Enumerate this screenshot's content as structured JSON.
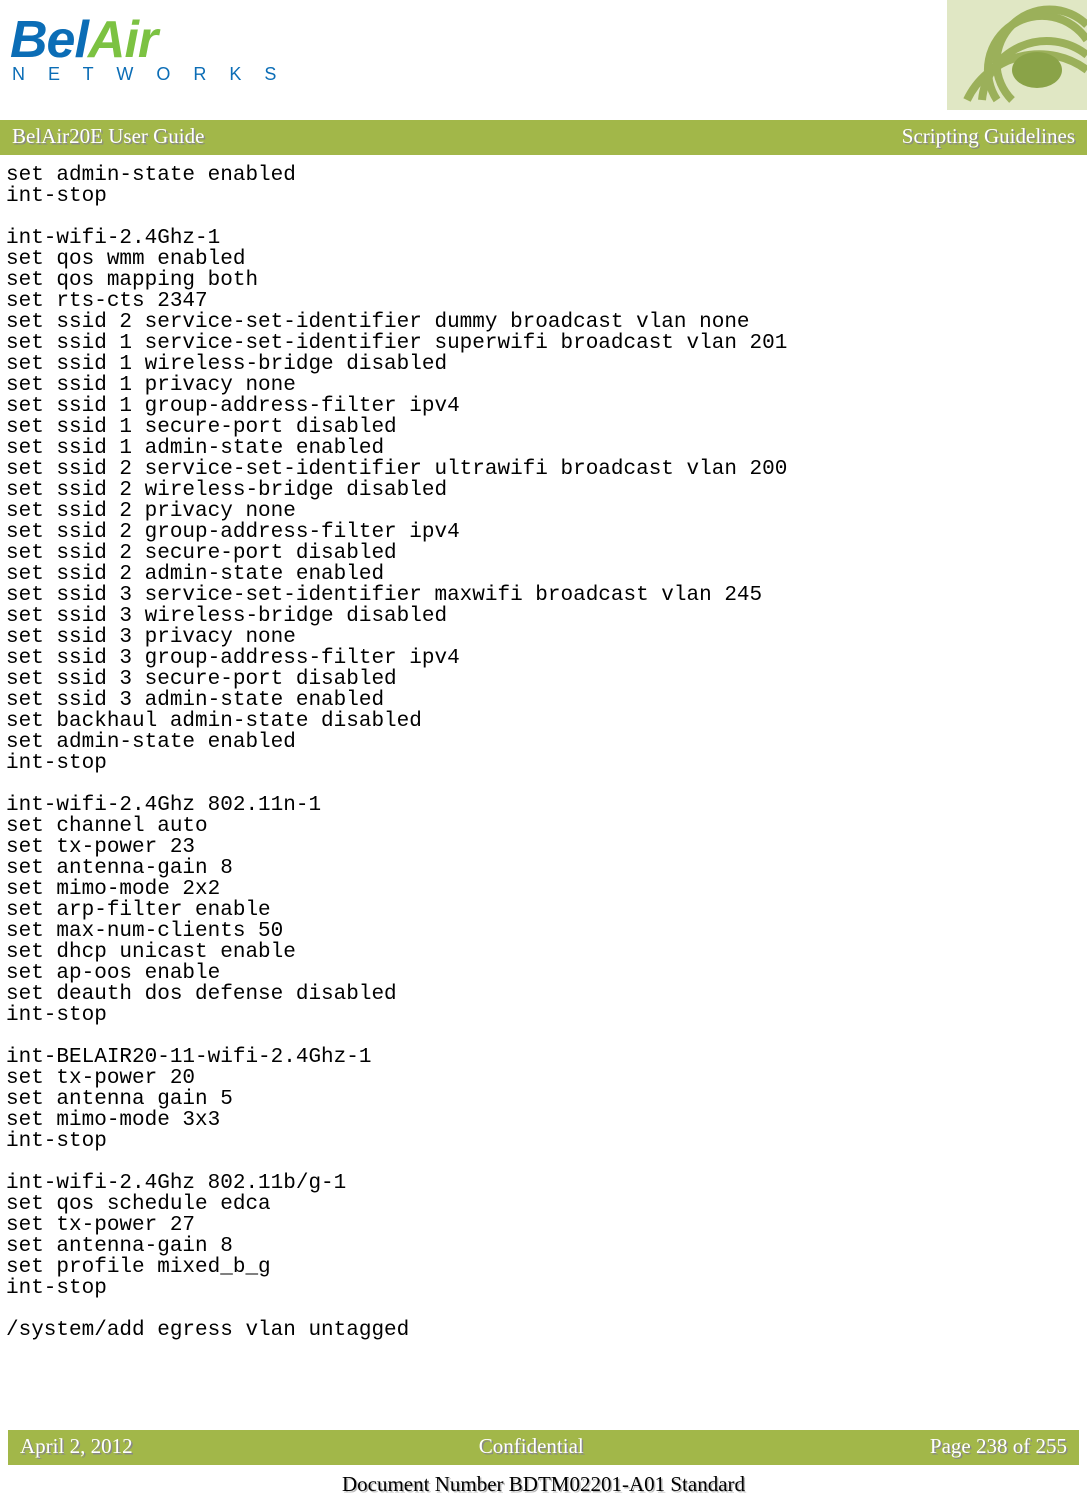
{
  "logo": {
    "part1": "Bel",
    "part2": "Air",
    "subtitle": "N E T W O R K S"
  },
  "titlebar": {
    "left": "BelAir20E User Guide",
    "right": "Scripting Guidelines"
  },
  "code": "set admin-state enabled\nint-stop\n\nint-wifi-2.4Ghz-1\nset qos wmm enabled\nset qos mapping both\nset rts-cts 2347\nset ssid 2 service-set-identifier dummy broadcast vlan none\nset ssid 1 service-set-identifier superwifi broadcast vlan 201\nset ssid 1 wireless-bridge disabled\nset ssid 1 privacy none\nset ssid 1 group-address-filter ipv4\nset ssid 1 secure-port disabled\nset ssid 1 admin-state enabled\nset ssid 2 service-set-identifier ultrawifi broadcast vlan 200\nset ssid 2 wireless-bridge disabled\nset ssid 2 privacy none\nset ssid 2 group-address-filter ipv4\nset ssid 2 secure-port disabled\nset ssid 2 admin-state enabled\nset ssid 3 service-set-identifier maxwifi broadcast vlan 245\nset ssid 3 wireless-bridge disabled\nset ssid 3 privacy none\nset ssid 3 group-address-filter ipv4\nset ssid 3 secure-port disabled\nset ssid 3 admin-state enabled\nset backhaul admin-state disabled\nset admin-state enabled\nint-stop\n\nint-wifi-2.4Ghz 802.11n-1\nset channel auto\nset tx-power 23\nset antenna-gain 8\nset mimo-mode 2x2\nset arp-filter enable\nset max-num-clients 50\nset dhcp unicast enable\nset ap-oos enable\nset deauth dos defense disabled\nint-stop\n\nint-BELAIR20-11-wifi-2.4Ghz-1\nset tx-power 20\nset antenna gain 5\nset mimo-mode 3x3\nint-stop\n\nint-wifi-2.4Ghz 802.11b/g-1\nset qos schedule edca\nset tx-power 27\nset antenna-gain 8\nset profile mixed_b_g\nint-stop\n\n/system/add egress vlan untagged",
  "footer": {
    "left": "April 2, 2012",
    "center": "Confidential",
    "right": "Page 238 of 255",
    "docnum": "Document Number BDTM02201-A01 Standard"
  }
}
